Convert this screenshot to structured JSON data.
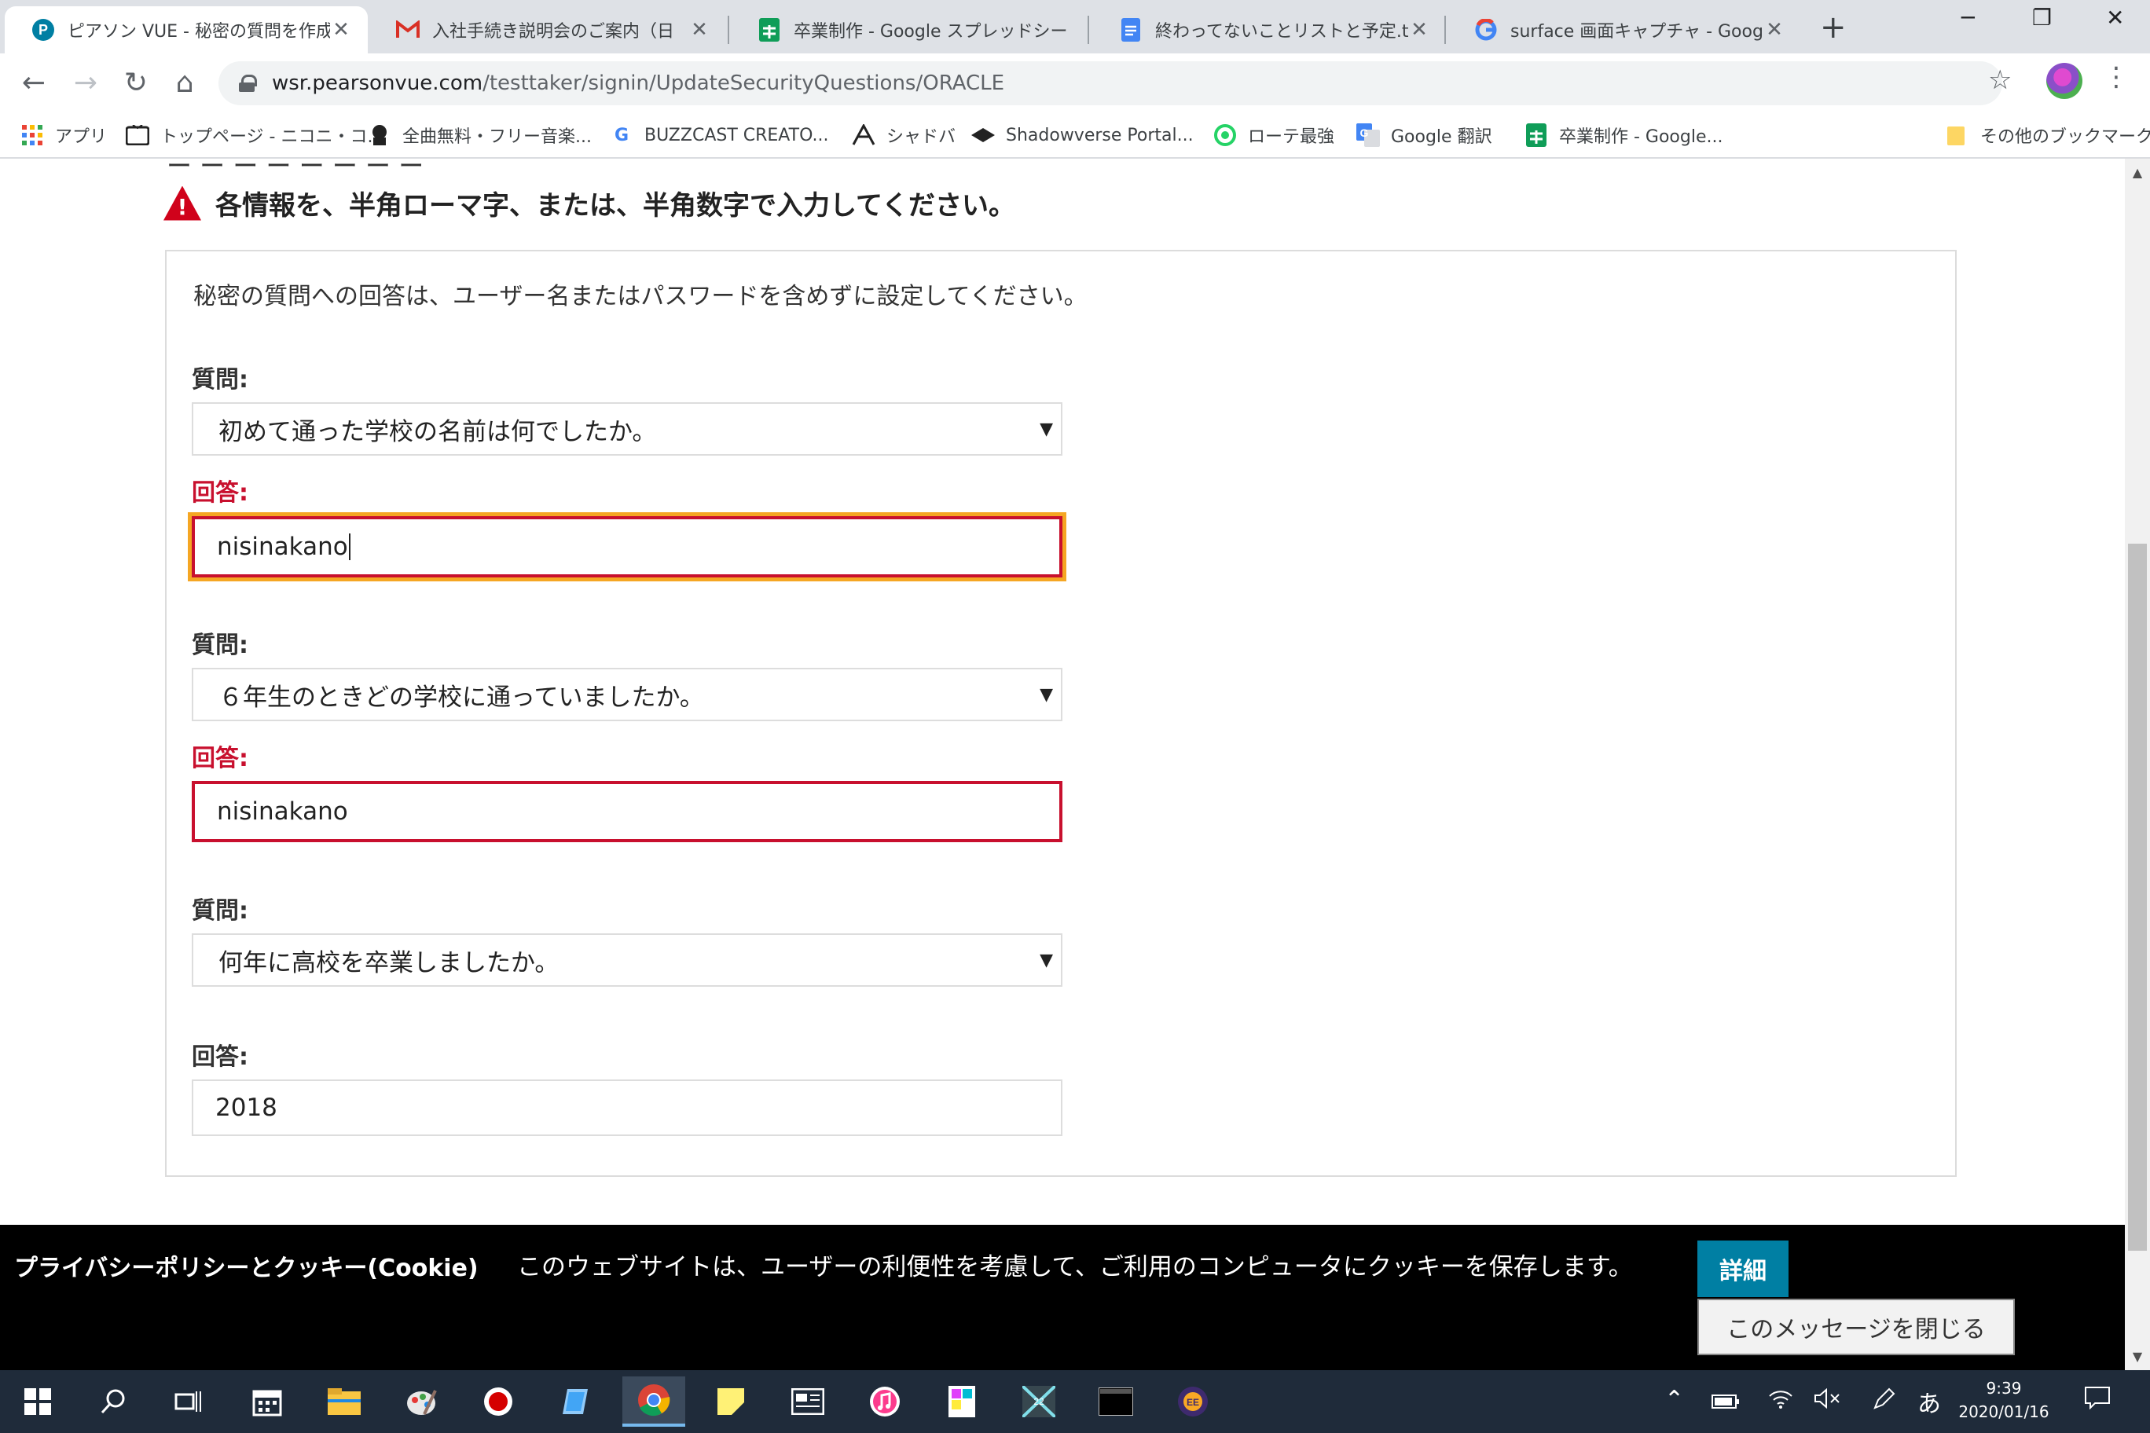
{
  "browser": {
    "tabs": [
      {
        "title": "ピアソン VUE - 秘密の質問を作成",
        "active": true
      },
      {
        "title": "入社手続き説明会のご案内（日",
        "active": false
      },
      {
        "title": "卒業制作 - Google スプレッドシー",
        "active": false
      },
      {
        "title": "終わってないことリストと予定.txt - ",
        "active": false
      },
      {
        "title": "surface 画面キャプチャ - Google",
        "active": false
      }
    ],
    "url_host": "wsr.pearsonvue.com",
    "url_path": "/testtaker/signin/UpdateSecurityQuestions/ORACLE",
    "new_tab": "+",
    "window_controls": {
      "minimize": "─",
      "restore": "❐",
      "close": "✕"
    },
    "nav": {
      "back": "←",
      "forward": "→",
      "reload": "↻",
      "home": "⌂"
    },
    "star": "☆",
    "menu": "⋮"
  },
  "bookmarks": [
    {
      "label": "アプリ",
      "icon": "apps-grid-icon"
    },
    {
      "label": "トップページ - ニコニ・コ...",
      "icon": "niconico-icon"
    },
    {
      "label": "全曲無料・フリー音楽...",
      "icon": "music-icon"
    },
    {
      "label": "BUZZCAST CREATO...",
      "icon": "google-icon"
    },
    {
      "label": "シャドバ",
      "icon": "shadowverse-icon"
    },
    {
      "label": "Shadowverse Portal...",
      "icon": "portal-icon"
    },
    {
      "label": "ローテ最強",
      "icon": "whatsapp-icon"
    },
    {
      "label": "Google 翻訳",
      "icon": "translate-icon"
    },
    {
      "label": "卒業制作 - Google...",
      "icon": "sheets-icon"
    },
    {
      "label": "その他のブックマーク",
      "icon": "folder-icon"
    }
  ],
  "page": {
    "cutoff_text": "ー  ー  ー  ー  ー  ー  ー  ー",
    "warning": "各情報を、半角ローマ字、または、半角数字で入力してください。",
    "intro": "秘密の質問への回答は、ユーザー名またはパスワードを含めずに設定してください。",
    "question_label": "質問:",
    "answer_label": "回答:",
    "questions": [
      {
        "question": "初めて通った学校の名前は何でしたか。",
        "answer": "nisinakano",
        "error": true,
        "focused": true
      },
      {
        "question": "６年生のときどの学校に通っていましたか。",
        "answer": "nisinakano",
        "error": true,
        "focused": false
      },
      {
        "question": "何年に高校を卒業しましたか。",
        "answer": "2018",
        "error": false,
        "focused": false
      }
    ]
  },
  "cookie_banner": {
    "heading": "プライバシーポリシーとクッキー(Cookie)",
    "message": "このウェブサイトは、ユーザーの利便性を考慮して、ご利用のコンピュータにクッキーを保存します。",
    "details_button": "詳細",
    "close_button": "このメッセージを閉じる"
  },
  "taskbar": {
    "time": "9:39",
    "date": "2020/01/16",
    "ime": "あ"
  },
  "colors": {
    "error": "#c8102e",
    "focus_ring": "#f5a623",
    "details_button": "#007fa3",
    "taskbar": "#1f2b3a"
  }
}
